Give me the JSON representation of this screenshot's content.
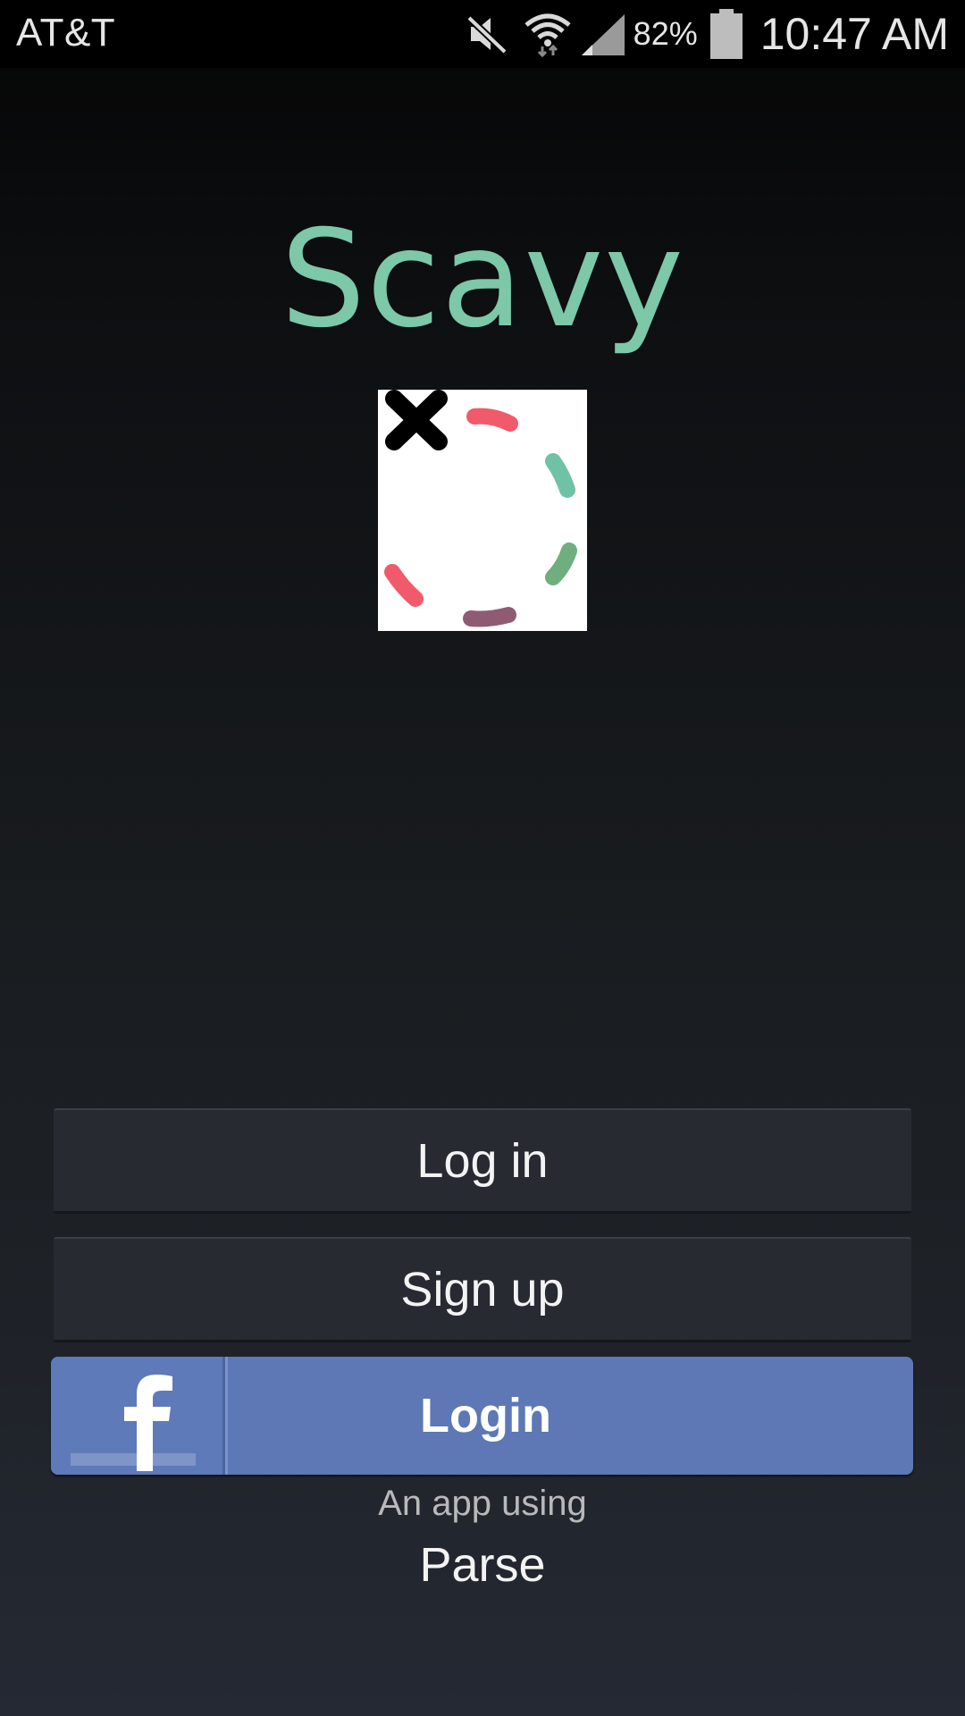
{
  "status_bar": {
    "carrier": "AT&T",
    "battery_percent": "82%",
    "time": "10:47 AM",
    "icons": [
      "mute-icon",
      "wifi-icon",
      "signal-icon",
      "battery-icon"
    ]
  },
  "app": {
    "title": "Scavy",
    "title_color": "#7cc8a9",
    "logo_icon": "dotted-circle-x-logo"
  },
  "buttons": {
    "login_label": "Log in",
    "signup_label": "Sign up",
    "facebook_login_label": "Login",
    "facebook_color": "#5d78b5"
  },
  "footer": {
    "using_text": "An app using",
    "provider": "Parse"
  }
}
